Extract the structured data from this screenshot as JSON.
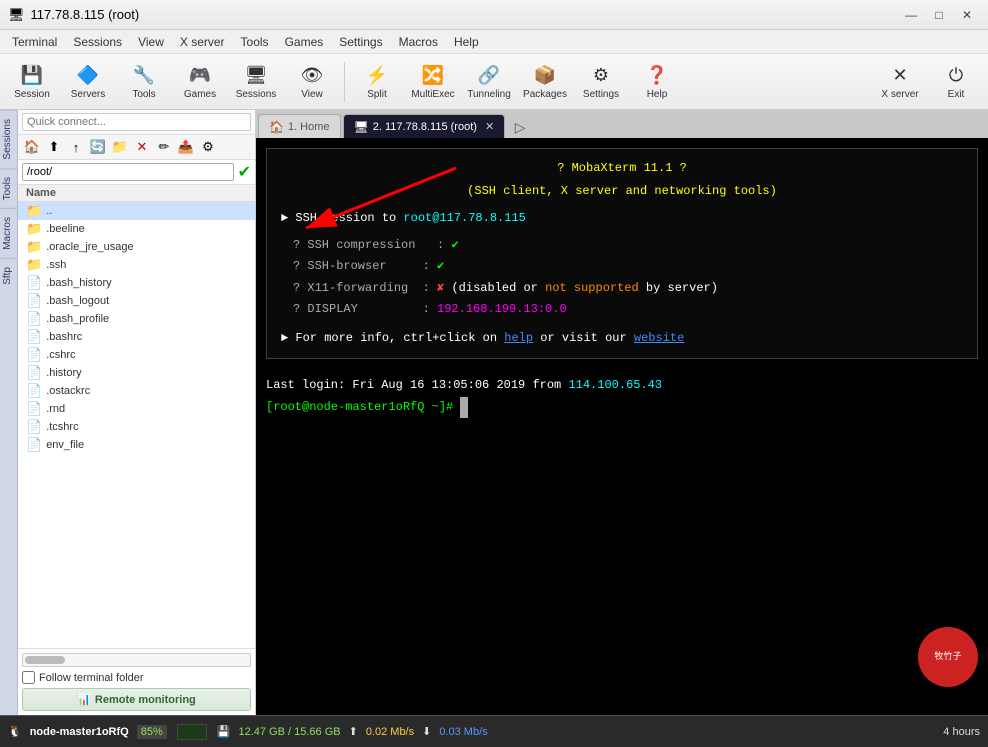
{
  "titlebar": {
    "title": "117.78.8.115 (root)",
    "icon": "🖥",
    "min_btn": "—",
    "max_btn": "□",
    "close_btn": "✕"
  },
  "menubar": {
    "items": [
      "Terminal",
      "Sessions",
      "View",
      "X server",
      "Tools",
      "Games",
      "Settings",
      "Macros",
      "Help"
    ]
  },
  "toolbar": {
    "buttons": [
      {
        "label": "Session",
        "icon": "💾"
      },
      {
        "label": "Servers",
        "icon": "🔷"
      },
      {
        "label": "Tools",
        "icon": "🔧"
      },
      {
        "label": "Games",
        "icon": "🎮"
      },
      {
        "label": "Sessions",
        "icon": "🖥"
      },
      {
        "label": "View",
        "icon": "👁"
      },
      {
        "label": "Split",
        "icon": "⚡"
      },
      {
        "label": "MultiExec",
        "icon": "🔀"
      },
      {
        "label": "Tunneling",
        "icon": "🔗"
      },
      {
        "label": "Packages",
        "icon": "📦"
      },
      {
        "label": "Settings",
        "icon": "⚙"
      },
      {
        "label": "Help",
        "icon": "❓"
      }
    ],
    "right_buttons": [
      {
        "label": "X server",
        "icon": "✕"
      },
      {
        "label": "Exit",
        "icon": "⏻"
      }
    ]
  },
  "sidebar": {
    "labels": [
      "Sessions",
      "Tools",
      "Macros",
      "Sftp"
    ]
  },
  "left_panel": {
    "quick_connect_placeholder": "Quick connect...",
    "path": "/root/",
    "file_list_header": "Name",
    "files": [
      {
        "name": "..",
        "type": "folder"
      },
      {
        "name": ".beeline",
        "type": "folder"
      },
      {
        "name": ".oracle_jre_usage",
        "type": "folder"
      },
      {
        "name": ".ssh",
        "type": "folder"
      },
      {
        "name": ".bash_history",
        "type": "file"
      },
      {
        "name": ".bash_logout",
        "type": "file"
      },
      {
        "name": ".bash_profile",
        "type": "file"
      },
      {
        "name": ".bashrc",
        "type": "file"
      },
      {
        "name": ".cshrc",
        "type": "file"
      },
      {
        "name": ".history",
        "type": "file"
      },
      {
        "name": ".ostackrc",
        "type": "file"
      },
      {
        "name": ".rnd",
        "type": "file"
      },
      {
        "name": ".tcshrc",
        "type": "file"
      },
      {
        "name": "env_file",
        "type": "file"
      }
    ],
    "follow_folder_label": "Follow terminal folder",
    "remote_monitoring_label": "Remote monitoring",
    "remote_monitoring_icon": "📊"
  },
  "tabs": [
    {
      "label": "1. Home",
      "icon": "🏠",
      "active": false,
      "closeable": false
    },
    {
      "label": "2. 117.78.8.115 (root)",
      "icon": "🖥",
      "active": true,
      "closeable": true
    }
  ],
  "terminal": {
    "info_box": {
      "line1": "? MobaXterm 11.1 ?",
      "line2": "(SSH client, X server and networking tools)",
      "line3": "► SSH session to root@117.78.8.115",
      "checks": [
        {
          "label": "SSH compression",
          "value": "✔",
          "ok": true
        },
        {
          "label": "SSH-browser",
          "value": "✔",
          "ok": true
        },
        {
          "label": "X11-forwarding",
          "value": "✘",
          "ok": false,
          "extra": "(disabled or not supported by server)"
        },
        {
          "label": "DISPLAY",
          "value": "192.168.199.13:0.0",
          "ok": false
        }
      ],
      "footer": "► For more info, ctrl+click on help or visit our website"
    },
    "last_login": "Last login: Fri Aug 16 13:05:06 2019 from 114.100.65.43",
    "prompt": "[root@node-master1oRfQ ~]# "
  },
  "statusbar": {
    "hostname": "node-master1oRfQ",
    "cpu_percent": "85%",
    "disk": "12.47 GB / 15.66 GB",
    "upload": "0.02 Mb/s",
    "download": "0.03 Mb/s",
    "time": "4 hours"
  },
  "watermark": {
    "line1": "牧竹子",
    "line2": ""
  },
  "colors": {
    "accent_blue": "#4488ff",
    "term_yellow": "#ffff00",
    "term_green": "#00ff00",
    "term_cyan": "#00ffff",
    "term_magenta": "#ff00ff",
    "status_green": "#8fdf5f"
  }
}
